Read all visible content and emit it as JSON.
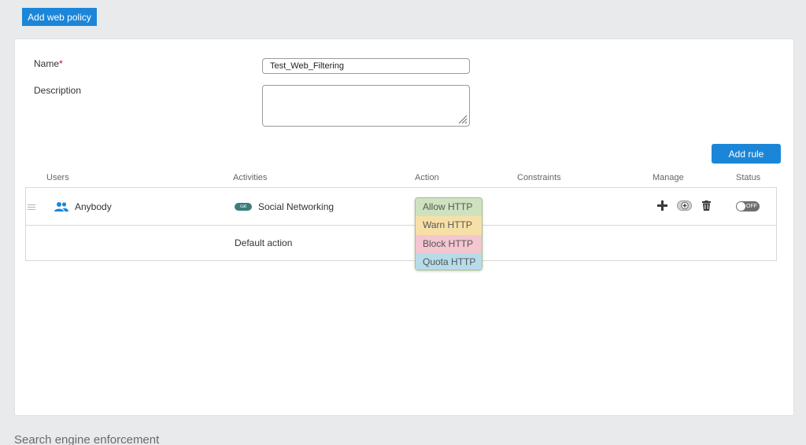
{
  "header": {
    "add_policy_label": "Add web policy"
  },
  "form": {
    "name_label": "Name",
    "required_mark": "*",
    "name_value": "Test_Web_Filtering",
    "description_label": "Description",
    "description_value": ""
  },
  "add_rule_label": "Add rule",
  "table": {
    "columns": [
      "Users",
      "Activities",
      "Action",
      "Constraints",
      "Manage",
      "Status"
    ],
    "rule": {
      "user": "Anybody",
      "activity_badge": "cat",
      "activity": "Social Networking",
      "status": "OFF"
    },
    "default_row_label": "Default action"
  },
  "action_options": [
    {
      "label": "Allow HTTP",
      "color": "#cfe2bf"
    },
    {
      "label": "Warn HTTP",
      "color": "#f7e0a8"
    },
    {
      "label": "Block HTTP",
      "color": "#f3c6d0"
    },
    {
      "label": "Quota HTTP",
      "color": "#b6dcea"
    }
  ],
  "icons": {
    "users": "users-icon",
    "add": "plus-icon",
    "add_exception": "add-circle-icon",
    "delete": "trash-icon",
    "drag": "drag-handle-icon",
    "resize": "resize-grip-icon"
  },
  "colors": {
    "accent": "#1b86d8",
    "badge": "#3d7d7a",
    "required": "#d0021b"
  },
  "next_section_title": "Search engine enforcement"
}
